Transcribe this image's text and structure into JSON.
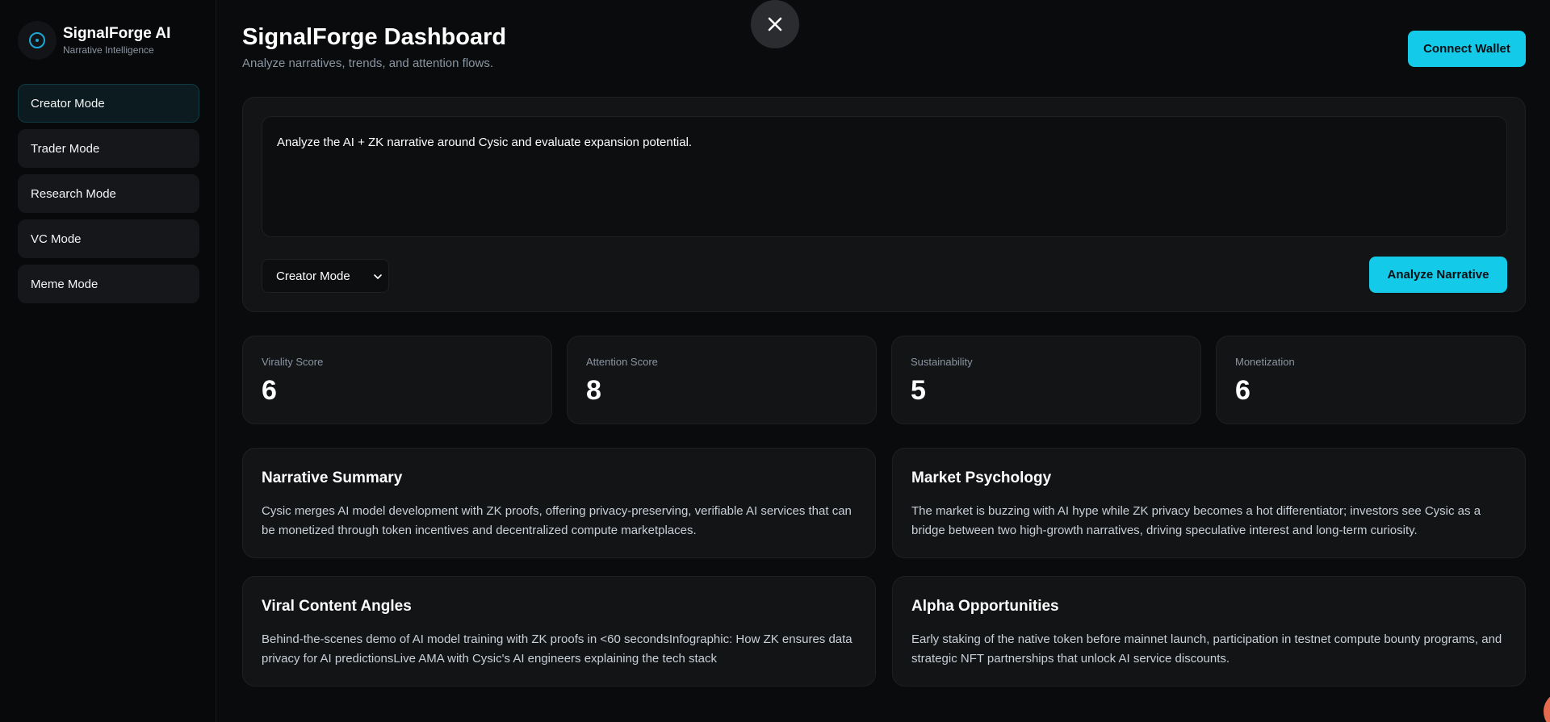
{
  "brand": {
    "name": "SignalForge AI",
    "subtitle": "Narrative Intelligence"
  },
  "sidebar": {
    "items": [
      {
        "label": "Creator Mode",
        "active": true
      },
      {
        "label": "Trader Mode",
        "active": false
      },
      {
        "label": "Research Mode",
        "active": false
      },
      {
        "label": "VC Mode",
        "active": false
      },
      {
        "label": "Meme Mode",
        "active": false
      }
    ]
  },
  "header": {
    "title": "SignalForge Dashboard",
    "subtitle": "Analyze narratives, trends, and attention flows.",
    "connect_label": "Connect Wallet"
  },
  "input": {
    "prompt": "Analyze the AI + ZK narrative around Cysic and evaluate expansion potential.",
    "mode_selected": "Creator Mode",
    "analyze_label": "Analyze Narrative"
  },
  "scores": [
    {
      "label": "Virality Score",
      "value": "6"
    },
    {
      "label": "Attention Score",
      "value": "8"
    },
    {
      "label": "Sustainability",
      "value": "5"
    },
    {
      "label": "Monetization",
      "value": "6"
    }
  ],
  "cards": [
    {
      "title": "Narrative Summary",
      "body": "Cysic merges AI model development with ZK proofs, offering privacy-preserving, verifiable AI services that can be monetized through token incentives and decentralized compute marketplaces."
    },
    {
      "title": "Market Psychology",
      "body": "The market is buzzing with AI hype while ZK privacy becomes a hot differentiator; investors see Cysic as a bridge between two high-growth narratives, driving speculative interest and long-term curiosity."
    },
    {
      "title": "Viral Content Angles",
      "body": "Behind-the-scenes demo of AI model training with ZK proofs in <60 secondsInfographic: How ZK ensures data privacy for AI predictionsLive AMA with Cysic's AI engineers explaining the tech stack"
    },
    {
      "title": "Alpha Opportunities",
      "body": "Early staking of the native token before mainnet launch, participation in testnet compute bounty programs, and strategic NFT partnerships that unlock AI service discounts."
    }
  ],
  "colors": {
    "accent": "#13cbe9",
    "background": "#0a0b0c",
    "card": "#131416",
    "muted_text": "#8b96a3"
  }
}
